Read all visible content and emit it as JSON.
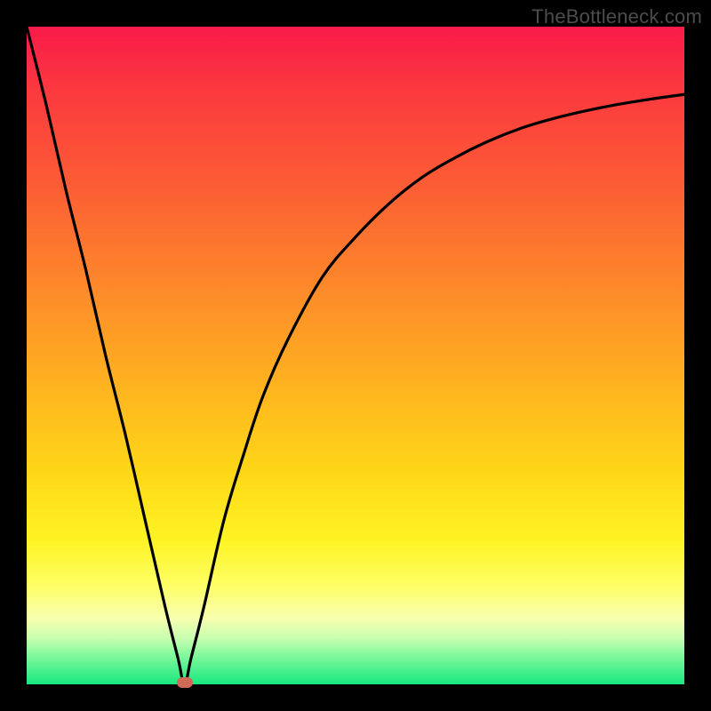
{
  "watermark": "TheBottleneck.com",
  "chart_data": {
    "type": "line",
    "title": "",
    "xlabel": "",
    "ylabel": "",
    "xlim": [
      0,
      100
    ],
    "ylim": [
      0,
      100
    ],
    "grid": false,
    "legend": false,
    "background": "vertical-gradient-red-to-green",
    "optimum_x": 24,
    "marker": {
      "x": 24,
      "y": 0,
      "color": "#d06a56"
    },
    "series": [
      {
        "name": "bottleneck-curve",
        "color": "#000000",
        "x": [
          0,
          3,
          6,
          9,
          12,
          15,
          18,
          21,
          23,
          24,
          25,
          27,
          30,
          33,
          36,
          40,
          45,
          50,
          55,
          60,
          65,
          70,
          75,
          80,
          85,
          90,
          95,
          100
        ],
        "y": [
          100,
          88,
          75,
          63,
          50,
          38,
          25,
          12,
          4,
          0,
          4,
          12,
          25,
          35,
          44,
          53,
          62,
          68,
          73,
          77,
          80,
          82.5,
          84.5,
          86,
          87.2,
          88.2,
          89,
          89.7
        ]
      }
    ]
  }
}
